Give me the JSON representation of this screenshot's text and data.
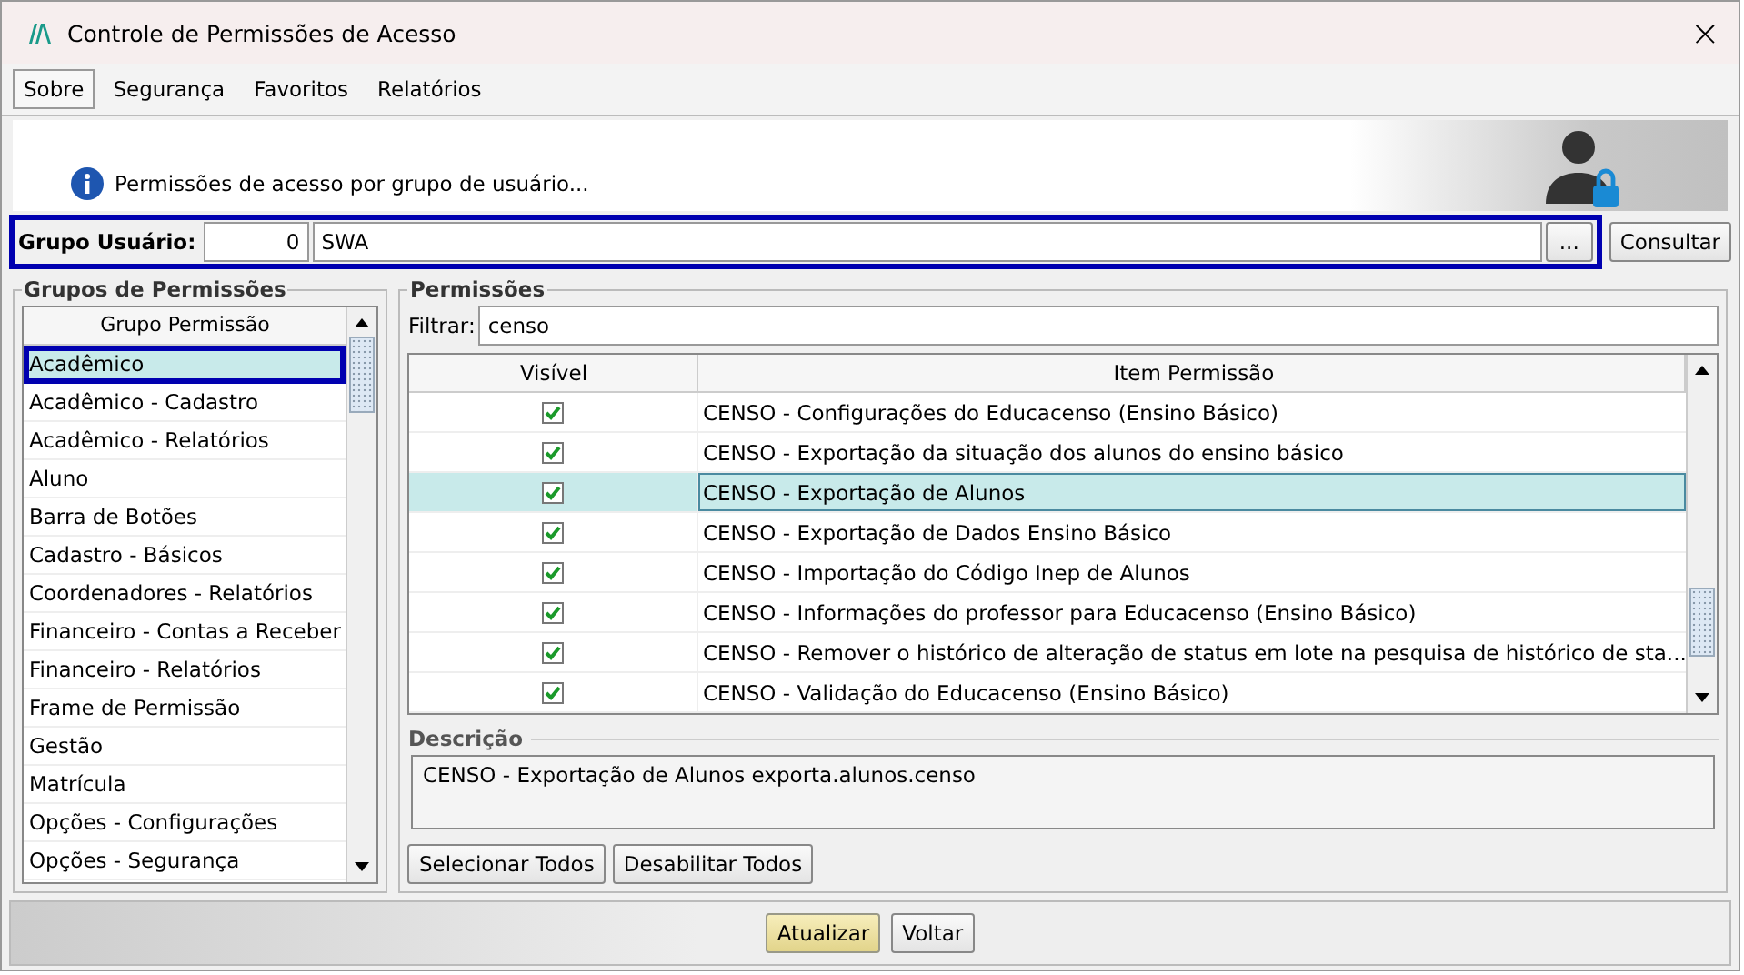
{
  "window": {
    "title": "Controle de Permissões de Acesso",
    "close": "×"
  },
  "menu": [
    {
      "label": "Sobre",
      "selected": true
    },
    {
      "label": "Segurança",
      "selected": false
    },
    {
      "label": "Favoritos",
      "selected": false
    },
    {
      "label": "Relatórios",
      "selected": false
    }
  ],
  "header": {
    "info": "Permissões de acesso por grupo de usuário..."
  },
  "grupo_usuario": {
    "label": "Grupo Usuário:",
    "code": "0",
    "name": "SWA",
    "browse": "...",
    "consult": "Consultar"
  },
  "grupos": {
    "title": "Grupos de Permissões",
    "column": "Grupo Permissão",
    "items": [
      {
        "label": "Acadêmico",
        "selected": true
      },
      {
        "label": "Acadêmico - Cadastro",
        "selected": false
      },
      {
        "label": "Acadêmico - Relatórios",
        "selected": false
      },
      {
        "label": "Aluno",
        "selected": false
      },
      {
        "label": "Barra de Botões",
        "selected": false
      },
      {
        "label": "Cadastro - Básicos",
        "selected": false
      },
      {
        "label": "Coordenadores - Relatórios",
        "selected": false
      },
      {
        "label": "Financeiro - Contas a Receber",
        "selected": false
      },
      {
        "label": "Financeiro - Relatórios",
        "selected": false
      },
      {
        "label": "Frame de Permissão",
        "selected": false
      },
      {
        "label": "Gestão",
        "selected": false
      },
      {
        "label": "Matrícula",
        "selected": false
      },
      {
        "label": "Opções - Configurações",
        "selected": false
      },
      {
        "label": "Opções - Segurança",
        "selected": false
      }
    ]
  },
  "permissoes": {
    "title": "Permissões",
    "filter_label": "Filtrar:",
    "filter": "censo",
    "columns": [
      "Visível",
      "Item Permissão"
    ],
    "rows": [
      {
        "item": "CENSO - Configurações do Educacenso (Ensino Básico)",
        "checked": true,
        "selected": false
      },
      {
        "item": "CENSO - Exportação da situação dos alunos do ensino básico",
        "checked": true,
        "selected": false
      },
      {
        "item": "CENSO - Exportação de Alunos",
        "checked": true,
        "selected": true
      },
      {
        "item": "CENSO - Exportação de Dados Ensino Básico",
        "checked": true,
        "selected": false
      },
      {
        "item": "CENSO - Importação do Código Inep de Alunos",
        "checked": true,
        "selected": false
      },
      {
        "item": "CENSO - Informações do professor para Educacenso (Ensino Básico)",
        "checked": true,
        "selected": false
      },
      {
        "item": "CENSO - Remover o histórico de alteração de status em lote na pesquisa de histórico de sta...",
        "checked": true,
        "selected": false
      },
      {
        "item": "CENSO - Validação do Educacenso (Ensino Básico)",
        "checked": true,
        "selected": false
      }
    ],
    "description_title": "Descrição",
    "description": "CENSO - Exportação de Alunos exporta.alunos.censo",
    "buttons": [
      "Selecionar Todos",
      "Desabilitar Todos"
    ]
  },
  "footer": {
    "buttons": [
      {
        "label": "Atualizar",
        "kind": "primary"
      },
      {
        "label": "Voltar",
        "kind": "normal"
      }
    ]
  }
}
